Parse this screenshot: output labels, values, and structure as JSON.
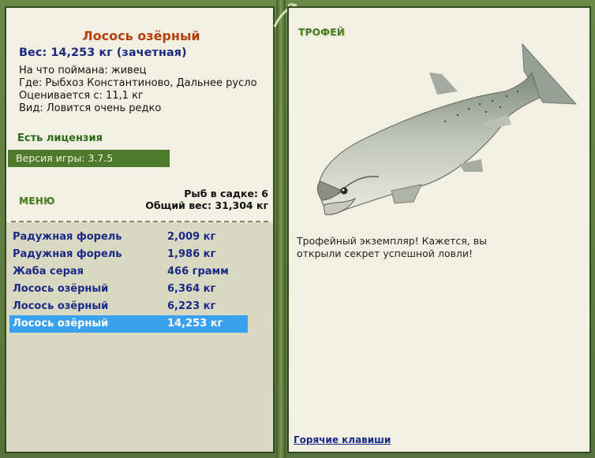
{
  "catch_details": {
    "title": "Лосось озёрный",
    "weight_line": "Вес: 14,253 кг (зачетная)",
    "bait": "На что поймана: живец",
    "location": "Где: Рыбхоз Константиново, Дальнее русло",
    "valued_from": "Оценивается с: 11,1 кг",
    "species_note": "Вид: Ловится очень редко"
  },
  "license_label": "Есть лицензия",
  "version_label": "Версия игры: 3.7.5",
  "menu_label": "МЕНЮ",
  "keep_net": {
    "count_label": "Рыб в садке: 6",
    "total_weight_label": "Общий вес: 31,304 кг"
  },
  "catch_list": [
    {
      "name": "Радужная форель",
      "weight": "2,009 кг"
    },
    {
      "name": "Радужная форель",
      "weight": "1,986 кг"
    },
    {
      "name": "Жаба серая",
      "weight": "466 грамм"
    },
    {
      "name": "Лосось озёрный",
      "weight": "6,364 кг"
    },
    {
      "name": "Лосось озёрный",
      "weight": "6,223 кг"
    },
    {
      "name": "Лосось озёрный",
      "weight": "14,253 кг"
    }
  ],
  "selected_index": 5,
  "trophy": {
    "heading": "ТРОФЕЙ",
    "message": "Трофейный экземпляр! Кажется, вы открыли секрет успешной ловли!"
  },
  "hotkeys_link": "Горячие клавиши",
  "colors": {
    "frame": "#5d7d3d",
    "panel": "#f1f0e3",
    "title": "#b4400c",
    "list_text": "#1a2a86",
    "selection": "#3aa0f0",
    "version_bar": "#4e7b2b"
  }
}
